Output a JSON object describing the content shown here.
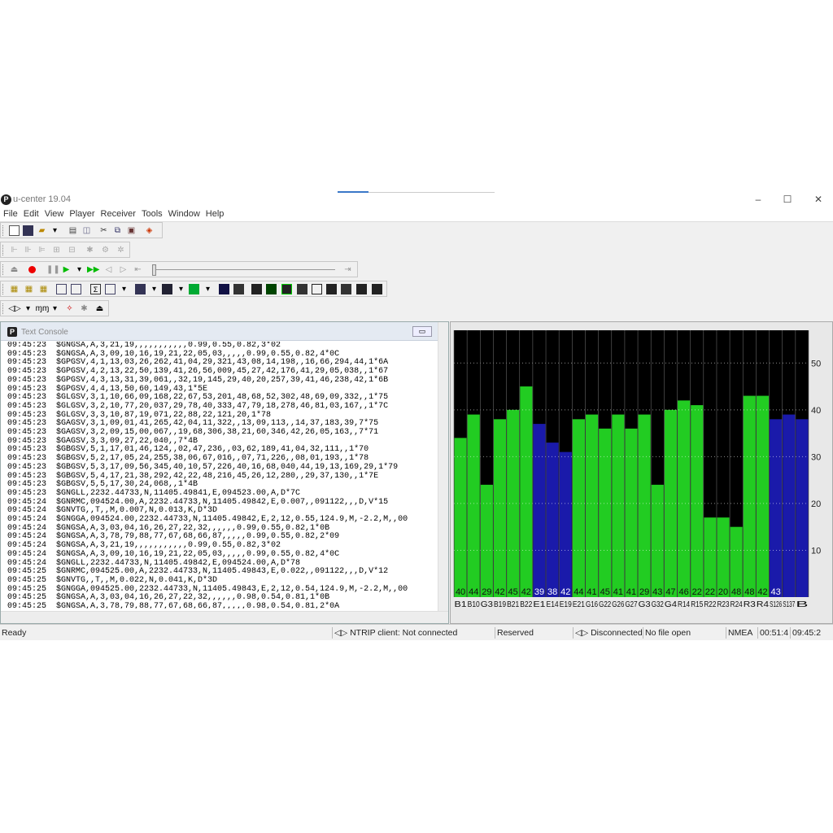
{
  "window": {
    "title": "u-center 19.04",
    "logo": "P",
    "minimize": "–",
    "maximize": "☐",
    "close": "✕"
  },
  "menu": [
    "File",
    "Edit",
    "View",
    "Player",
    "Receiver",
    "Tools",
    "Window",
    "Help"
  ],
  "console": {
    "title": "Text Console",
    "lines": [
      "09:45:23  $GNGSA,A,3,21,19,,,,,,,,,,,0.99,0.55,0.82,3*02",
      "09:45:23  $GNGSA,A,3,09,10,16,19,21,22,05,03,,,,,0.99,0.55,0.82,4*0C",
      "09:45:23  $GPGSV,4,1,13,03,26,262,41,04,29,321,43,08,14,198,,16,66,294,44,1*6A",
      "09:45:23  $GPGSV,4,2,13,22,50,139,41,26,56,009,45,27,42,176,41,29,05,038,,1*67",
      "09:45:23  $GPGSV,4,3,13,31,39,061,,32,19,145,29,40,20,257,39,41,46,238,42,1*6B",
      "09:45:23  $GPGSV,4,4,13,50,60,149,43,1*5E",
      "09:45:23  $GLGSV,3,1,10,66,09,168,22,67,53,201,48,68,52,302,48,69,09,332,,1*75",
      "09:45:23  $GLGSV,3,2,10,77,20,037,29,78,40,333,47,79,18,278,46,81,03,167,,1*7C",
      "09:45:23  $GLGSV,3,3,10,87,19,071,22,88,22,121,20,1*78",
      "09:45:23  $GAGSV,3,1,09,01,41,265,42,04,11,322,,13,09,113,,14,37,183,39,7*75",
      "09:45:23  $GAGSV,3,2,09,15,00,067,,19,68,306,38,21,60,346,42,26,05,163,,7*71",
      "09:45:23  $GAGSV,3,3,09,27,22,040,,7*4B",
      "09:45:23  $GBGSV,5,1,17,01,46,124,,02,47,236,,03,62,189,41,04,32,111,,1*70",
      "09:45:23  $GBGSV,5,2,17,05,24,255,38,06,67,016,,07,71,226,,08,01,193,,1*78",
      "09:45:23  $GBGSV,5,3,17,09,56,345,40,10,57,226,40,16,68,040,44,19,13,169,29,1*79",
      "09:45:23  $GBGSV,5,4,17,21,38,292,42,22,48,216,45,26,12,280,,29,37,130,,1*7E",
      "09:45:23  $GBGSV,5,5,17,30,24,068,,1*4B",
      "09:45:23  $GNGLL,2232.44733,N,11405.49841,E,094523.00,A,D*7C",
      "09:45:24  $GNRMC,094524.00,A,2232.44733,N,11405.49842,E,0.007,,091122,,,D,V*15",
      "09:45:24  $GNVTG,,T,,M,0.007,N,0.013,K,D*3D",
      "09:45:24  $GNGGA,094524.00,2232.44733,N,11405.49842,E,2,12,0.55,124.9,M,-2.2,M,,00",
      "09:45:24  $GNGSA,A,3,03,04,16,26,27,22,32,,,,,,0.99,0.55,0.82,1*0B",
      "09:45:24  $GNGSA,A,3,78,79,88,77,67,68,66,87,,,,,0.99,0.55,0.82,2*09",
      "09:45:24  $GNGSA,A,3,21,19,,,,,,,,,,,0.99,0.55,0.82,3*02",
      "09:45:24  $GNGSA,A,3,09,10,16,19,21,22,05,03,,,,,0.99,0.55,0.82,4*0C",
      "09:45:24  $GNGLL,2232.44733,N,11405.49842,E,094524.00,A,D*78",
      "09:45:25  $GNRMC,094525.00,A,2232.44733,N,11405.49843,E,0.022,,091122,,,D,V*12",
      "09:45:25  $GNVTG,,T,,M,0.022,N,0.041,K,D*3D",
      "09:45:25  $GNGGA,094525.00,2232.44733,N,11405.49843,E,2,12,0.54,124.9,M,-2.2,M,,00",
      "09:45:25  $GNGSA,A,3,03,04,16,26,27,22,32,,,,,,0.98,0.54,0.81,1*0B",
      "09:45:25  $GNGSA,A,3,78,79,88,77,67,68,66,87,,,,,0.98,0.54,0.81,2*0A"
    ]
  },
  "status": {
    "ready": "Ready",
    "ntrip": "NTRIP client: Not connected",
    "reserved": "Reserved",
    "connection": "Disconnected",
    "file": "No file open",
    "protocol": "NMEA",
    "elapsed": "00:51:4",
    "time": "09:45:2"
  },
  "chart_data": {
    "type": "bar",
    "title": "",
    "xlabel": "",
    "ylabel": "",
    "ylim": [
      0,
      57
    ],
    "y_ticks": [
      10,
      20,
      30,
      40,
      50
    ],
    "grid": true,
    "categories": [
      "B1",
      "B10",
      "G3",
      "B19",
      "B21",
      "B22",
      "E1",
      "E14",
      "E19",
      "E21",
      "G16",
      "G22",
      "G26",
      "G27",
      "G3",
      "G32",
      "G4",
      "R14",
      "R15",
      "R22",
      "R23",
      "R24",
      "R3",
      "R4",
      "S126",
      "S137",
      "B"
    ],
    "cno_labels": [
      "40",
      "44",
      "29",
      "42",
      "45",
      "42",
      "39",
      "38",
      "42",
      "44",
      "41",
      "45",
      "41",
      "41",
      "29",
      "43",
      "47",
      "46",
      "22",
      "22",
      "20",
      "48",
      "48",
      "42",
      "43"
    ],
    "values": [
      34,
      39,
      24,
      38,
      40,
      45,
      37,
      33,
      31,
      38,
      39,
      36,
      39,
      36,
      39,
      24,
      40,
      42,
      41,
      17,
      17,
      15,
      43,
      43,
      38,
      39,
      38
    ],
    "colors": [
      "green",
      "green",
      "green",
      "green",
      "green",
      "green",
      "blue",
      "blue",
      "blue",
      "green",
      "green",
      "green",
      "green",
      "green",
      "green",
      "green",
      "green",
      "green",
      "green",
      "green",
      "green",
      "green",
      "green",
      "green",
      "blue",
      "blue",
      "blue"
    ],
    "series_colors": {
      "green": "#22cc22",
      "blue": "#1a1aaa",
      "background": "#000000"
    }
  }
}
